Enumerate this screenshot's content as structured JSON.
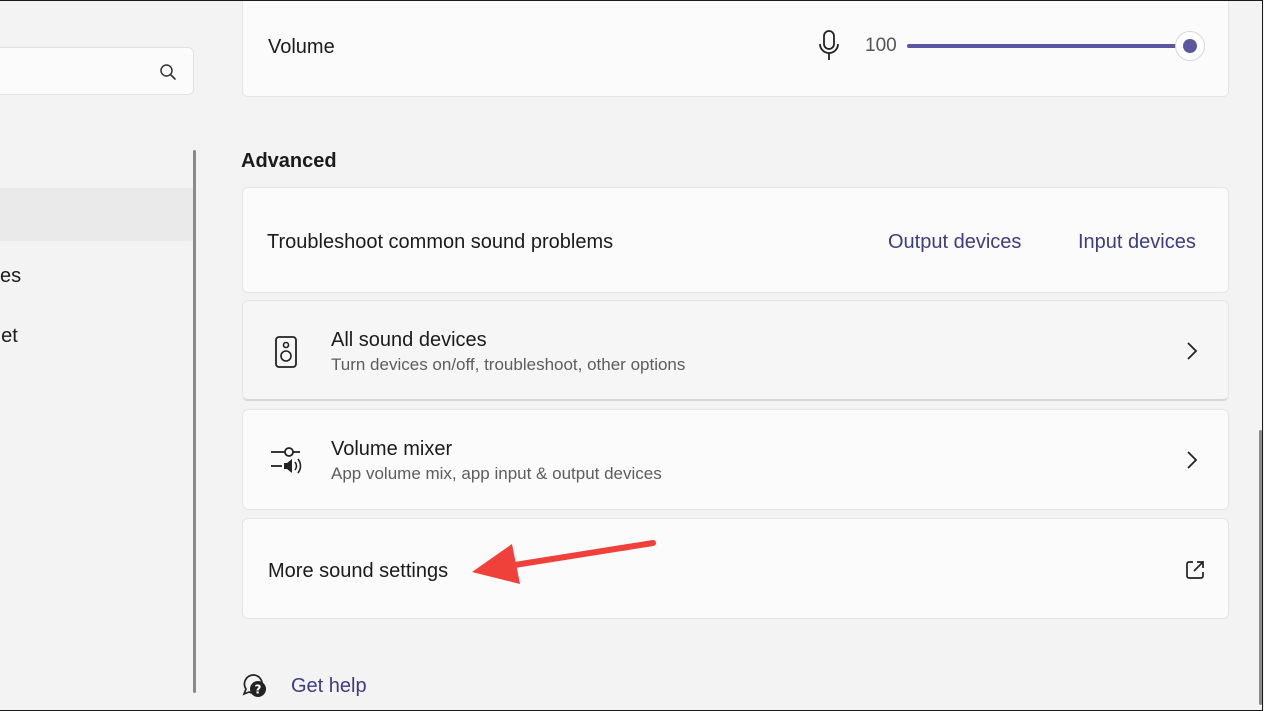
{
  "sidebar": {
    "search": {
      "icon": "search-icon"
    },
    "items": [
      {
        "label": "ces"
      },
      {
        "label": "net"
      }
    ]
  },
  "volume": {
    "label": "Volume",
    "value": "100",
    "level": 1.0,
    "icon": "microphone-icon"
  },
  "advanced": {
    "title": "Advanced",
    "troubleshoot": {
      "label": "Troubleshoot common sound problems",
      "output_link": "Output devices",
      "input_link": "Input devices"
    },
    "all_devices": {
      "title": "All sound devices",
      "subtitle": "Turn devices on/off, troubleshoot, other options",
      "icon": "speaker-icon"
    },
    "mixer": {
      "title": "Volume mixer",
      "subtitle": "App volume mix, app input & output devices",
      "icon": "mixer-icon"
    },
    "more": {
      "label": "More sound settings",
      "icon": "external-link-icon"
    }
  },
  "help": {
    "label": "Get help",
    "icon": "help-icon"
  },
  "colors": {
    "accent": "#5a57a0",
    "link": "#3e3c80",
    "annotation": "#f0403a"
  }
}
